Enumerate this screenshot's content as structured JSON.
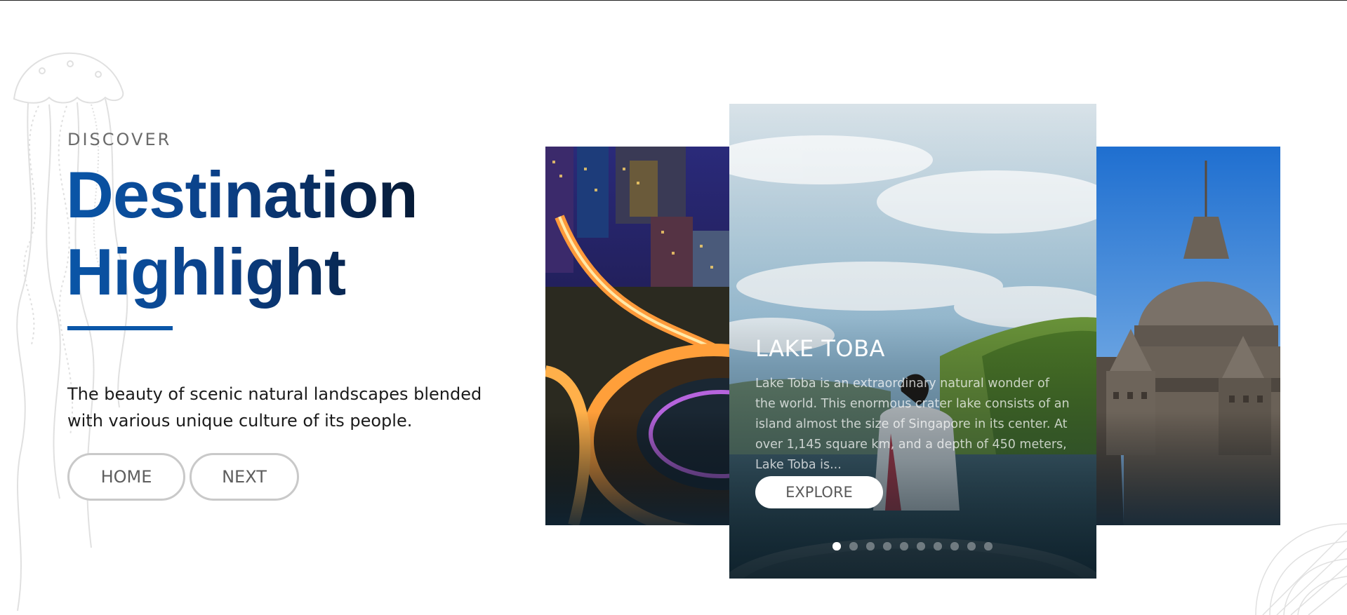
{
  "hero": {
    "eyebrow": "DISCOVER",
    "headline_line1": "Destination",
    "headline_line2": "Highlight",
    "description": "The beauty of scenic natural landscapes blended with various unique culture of its people.",
    "home_label": "HOME",
    "next_label": "NEXT"
  },
  "carousel": {
    "active_index": 0,
    "slide_count": 10,
    "cards": [
      {
        "image": "city-night-roundabout-photo"
      },
      {
        "image": "lake-toba-photo",
        "title": "LAKE TOBA",
        "description": "Lake Toba is an extraordinary natural wonder of the world. This enormous crater lake consists of an island almost the size of Singapore in its center. At over 1,145 square km, and a depth of 450 meters, Lake Toba is...",
        "cta_label": "EXPLORE"
      },
      {
        "image": "borobudur-stupa-photo"
      }
    ]
  },
  "colors": {
    "accent": "#0a56a8",
    "headline_dark": "#061a35",
    "button_border": "#c9c9c9"
  }
}
